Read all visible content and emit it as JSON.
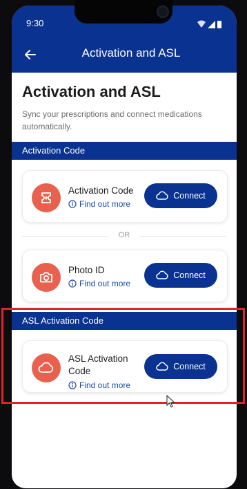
{
  "status": {
    "time": "9:30"
  },
  "appbar": {
    "title": "Activation and ASL"
  },
  "page": {
    "title": "Activation and ASL",
    "subtitle": "Sync your prescriptions and connect medications automatically."
  },
  "sections": {
    "activation": "Activation Code",
    "asl": "ASL Activation Code"
  },
  "cards": {
    "activation": {
      "title": "Activation Code",
      "link": "Find out more",
      "button": "Connect"
    },
    "photo": {
      "title": "Photo ID",
      "link": "Find out more",
      "button": "Connect"
    },
    "asl": {
      "title_line1": "ASL Activation",
      "title_line2": "Code",
      "link": "Find out more",
      "button": "Connect"
    }
  },
  "divider": {
    "label": "OR"
  },
  "colors": {
    "primary": "#0a3290",
    "accent": "#e8604e",
    "link": "#1a4cae",
    "highlight": "#e0232b"
  },
  "icons": {
    "back": "arrow-left-icon",
    "activation": "ticket-icon",
    "photo": "camera-icon",
    "asl": "cloud-icon",
    "connect": "cloud-icon",
    "info": "info-icon"
  }
}
